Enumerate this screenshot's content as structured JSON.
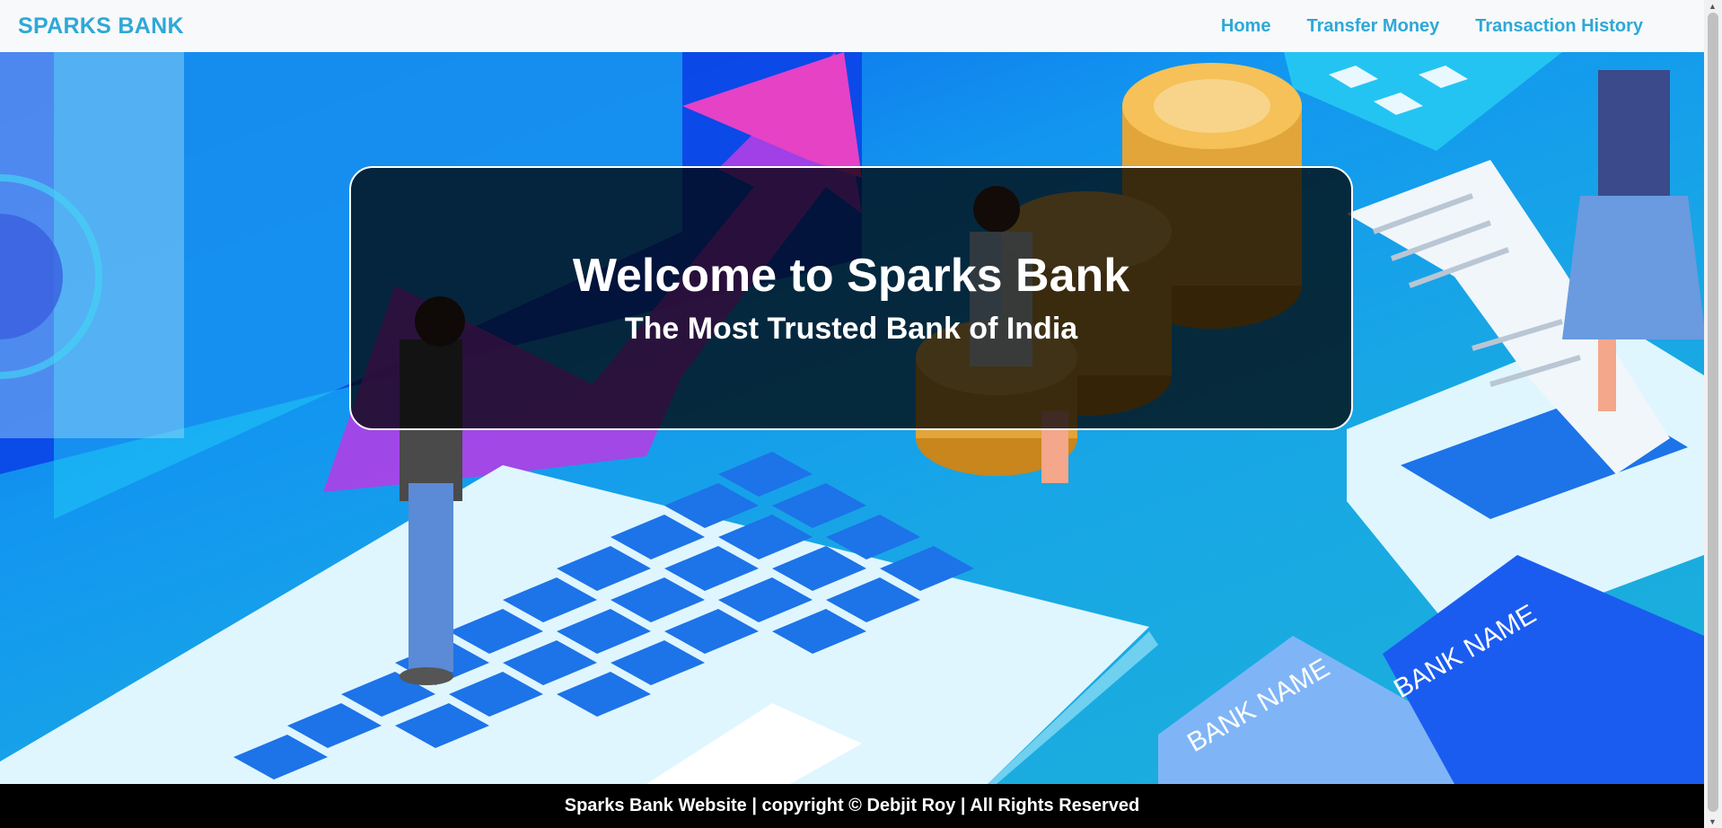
{
  "navbar": {
    "brand": "SPARKS BANK",
    "links": [
      "Home",
      "Transfer Money",
      "Transaction History"
    ]
  },
  "hero": {
    "title": "Welcome to Sparks Bank",
    "subtitle": "The Most Trusted Bank of India",
    "illustration": {
      "card_label": "BANK NAME"
    }
  },
  "footer": {
    "text": "Sparks Bank Website | copyright © Debjit Roy | All Rights Reserved"
  },
  "colors": {
    "brand": "#2ea8d8",
    "navbar_bg": "#f8f9fa",
    "footer_bg": "#000000",
    "hero_blue": "#1296f0"
  }
}
